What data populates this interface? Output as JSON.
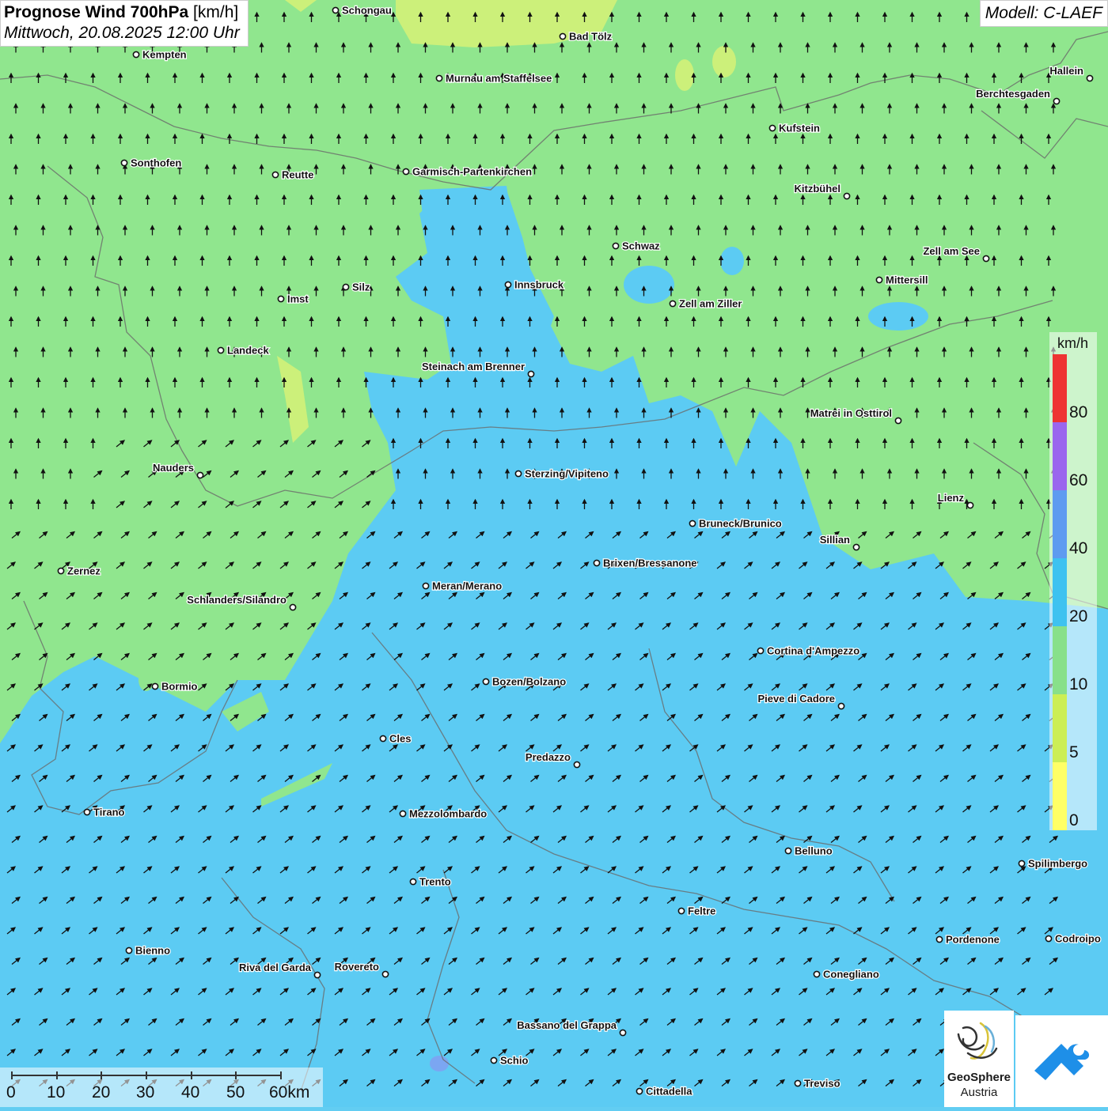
{
  "header": {
    "title_bold": "Prognose Wind 700hPa",
    "title_unit": " [km/h]",
    "subtitle": "Mittwoch, 20.08.2025 12:00 Uhr",
    "model": "Modell: C-LAEF"
  },
  "legend": {
    "unit": "km/h",
    "colors": [
      "#ffff66",
      "#ccee55",
      "#88e08a",
      "#3ec2f0",
      "#5e9bf0",
      "#9a66ee",
      "#ee3333"
    ],
    "ticks": [
      "0",
      "5",
      "10",
      "20",
      "40",
      "60",
      "80"
    ]
  },
  "scale": {
    "labels": [
      "0",
      "10",
      "20",
      "30",
      "40",
      "50",
      "60km"
    ]
  },
  "logos": {
    "geosphere_line1": "GeoSphere",
    "geosphere_line2": "Austria"
  },
  "wind": {
    "north_direction": "N",
    "south_direction": "NE"
  },
  "places": [
    {
      "name": "Schongau"
    },
    {
      "name": "Bad Tölz"
    },
    {
      "name": "Kempten"
    },
    {
      "name": "Murnau am Staffelsee"
    },
    {
      "name": "Hallein"
    },
    {
      "name": "Berchtesgaden"
    },
    {
      "name": "Kufstein"
    },
    {
      "name": "Sonthofen"
    },
    {
      "name": "Reutte"
    },
    {
      "name": "Garmisch-Partenkirchen"
    },
    {
      "name": "Kitzbühel"
    },
    {
      "name": "Schwaz"
    },
    {
      "name": "Zell am See"
    },
    {
      "name": "Innsbruck"
    },
    {
      "name": "Silz"
    },
    {
      "name": "Mittersill"
    },
    {
      "name": "Imst"
    },
    {
      "name": "Zell am Ziller"
    },
    {
      "name": "Landeck"
    },
    {
      "name": "Steinach am Brenner"
    },
    {
      "name": "Matrei in Osttirol"
    },
    {
      "name": "Nauders"
    },
    {
      "name": "Sterzing/Vipiteno"
    },
    {
      "name": "Lienz"
    },
    {
      "name": "Bruneck/Brunico"
    },
    {
      "name": "Sillian"
    },
    {
      "name": "Zernez"
    },
    {
      "name": "Brixen/Bressanone"
    },
    {
      "name": "Meran/Merano"
    },
    {
      "name": "Schlanders/Silandro"
    },
    {
      "name": "Cortina d'Ampezzo"
    },
    {
      "name": "Bozen/Bolzano"
    },
    {
      "name": "Bormio"
    },
    {
      "name": "Pieve di Cadore"
    },
    {
      "name": "Cles"
    },
    {
      "name": "Predazzo"
    },
    {
      "name": "Tirano"
    },
    {
      "name": "Mezzolombardo"
    },
    {
      "name": "Belluno"
    },
    {
      "name": "Spilimbergo"
    },
    {
      "name": "Trento"
    },
    {
      "name": "Feltre"
    },
    {
      "name": "Pordenone"
    },
    {
      "name": "Codroipo"
    },
    {
      "name": "Bienno"
    },
    {
      "name": "Riva del Garda"
    },
    {
      "name": "Rovereto"
    },
    {
      "name": "Conegliano"
    },
    {
      "name": "Bassano del Grappa"
    },
    {
      "name": "Schio"
    },
    {
      "name": "Treviso"
    },
    {
      "name": "Cittadella"
    }
  ]
}
